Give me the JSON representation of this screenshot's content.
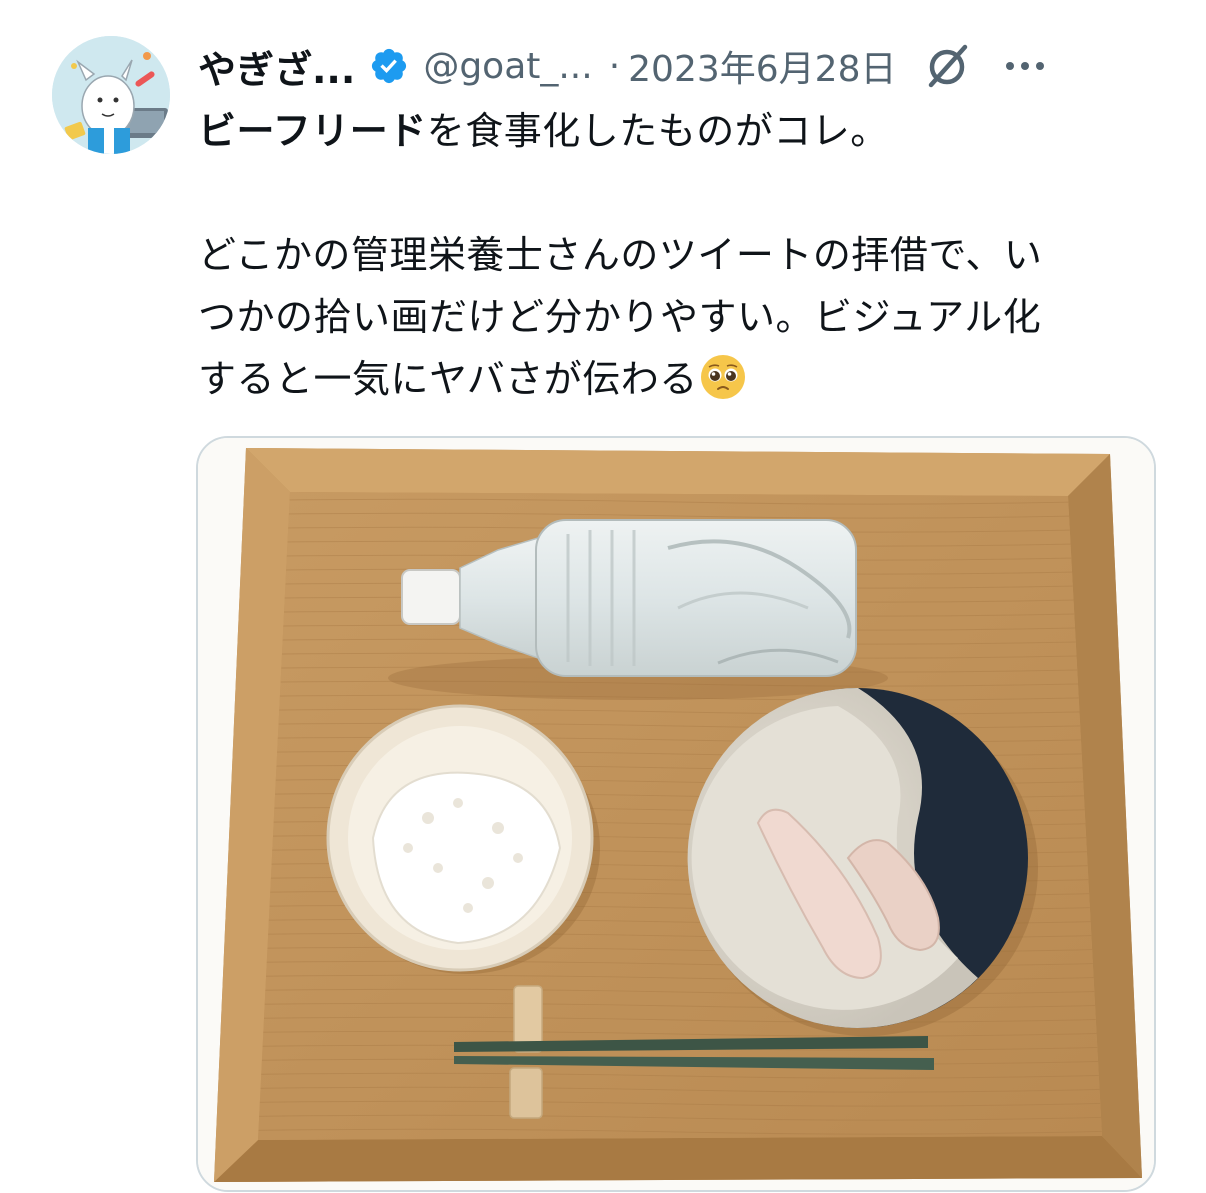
{
  "tweet": {
    "author_name": "やぎざ...",
    "handle": "@goat_...",
    "separator": "·",
    "date": "2023年6月28日",
    "text_line1_bold": "ビーフリード",
    "text_line1_rest": "を食事化したものがコレ。",
    "text_para2_line1": "どこかの管理栄養士さんのツイートの拝借で、い",
    "text_para2_line2": "つかの拾い画だけど分かりやすい。ビジュアル化",
    "text_para2_line3": "すると一気にヤバさが伝わる",
    "emoji": "pleading-face"
  },
  "colors": {
    "verified": "#1d9bf0",
    "secondary_text": "#536471",
    "primary_text": "#0f1419"
  },
  "icons": {
    "verified": "verified-badge-icon",
    "grok": "grok-icon",
    "more": "more-options-icon"
  }
}
